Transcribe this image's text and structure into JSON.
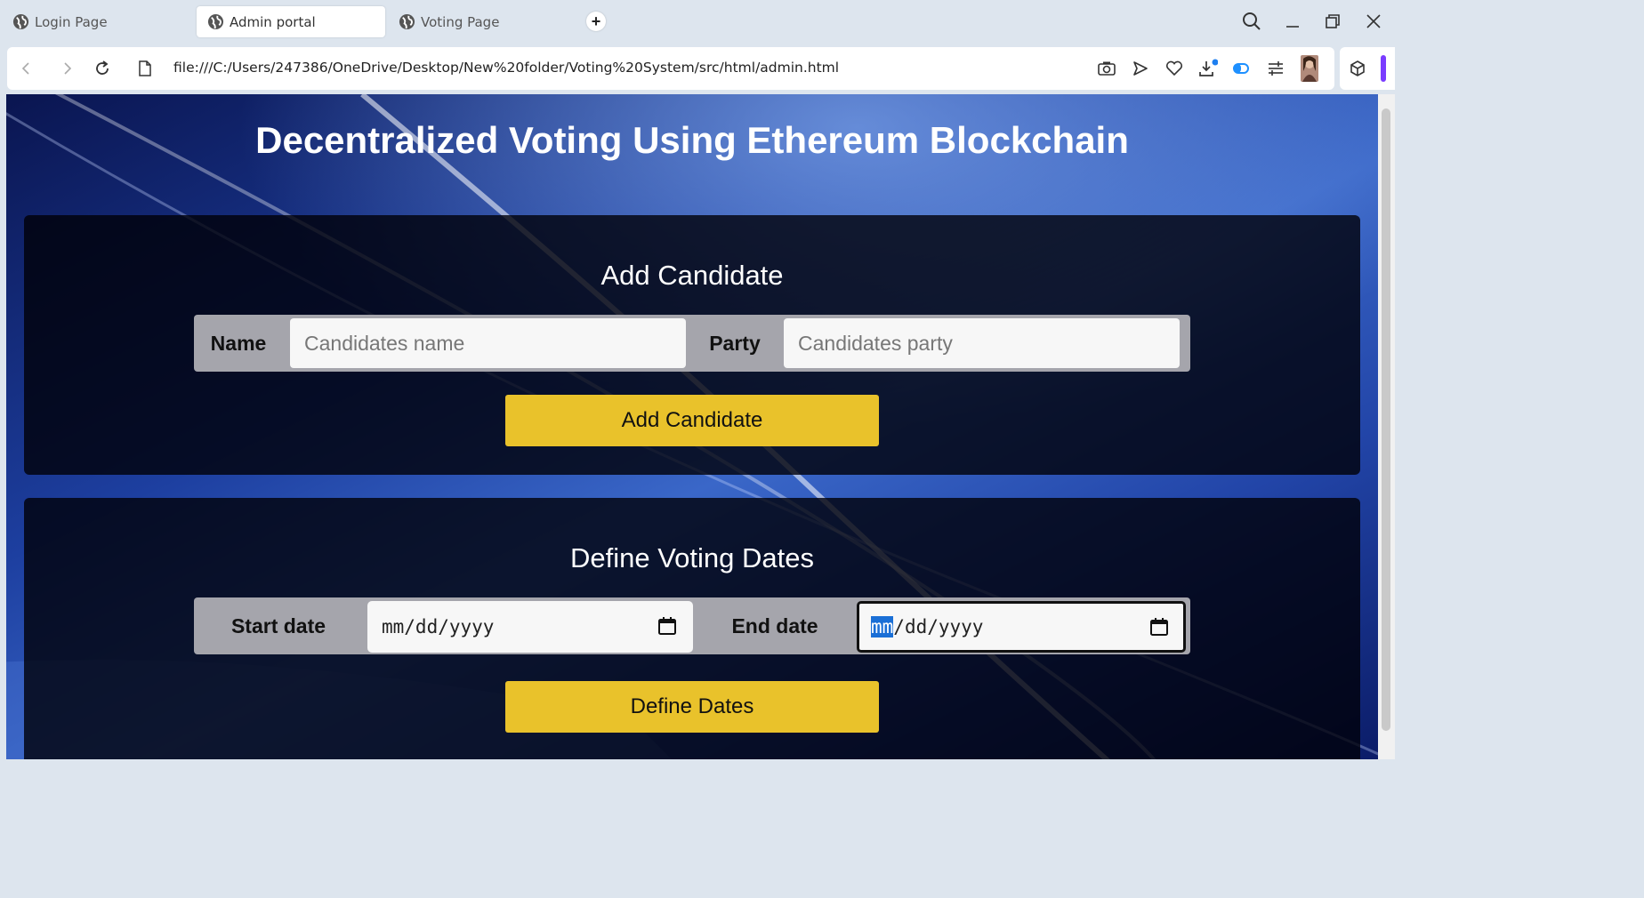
{
  "browser": {
    "tabs": [
      {
        "label": "Login Page",
        "active": false
      },
      {
        "label": "Admin portal",
        "active": true
      },
      {
        "label": "Voting Page",
        "active": false
      }
    ],
    "url": "file:///C:/Users/247386/OneDrive/Desktop/New%20folder/Voting%20System/src/html/admin.html"
  },
  "page": {
    "title": "Decentralized Voting Using Ethereum Blockchain",
    "add_candidate": {
      "heading": "Add Candidate",
      "name_label": "Name",
      "name_placeholder": "Candidates name",
      "party_label": "Party",
      "party_placeholder": "Candidates party",
      "button_label": "Add Candidate"
    },
    "voting_dates": {
      "heading": "Define Voting Dates",
      "start_label": "Start date",
      "start_value": "mm/dd/yyyy",
      "end_label": "End date",
      "end_value_highlight": "mm",
      "end_value_rest": "/dd/yyyy",
      "button_label": "Define Dates"
    }
  },
  "colors": {
    "button_yellow": "#e9c22b",
    "page_blue": "#0a1a55",
    "highlight_blue": "#1a6fd6"
  }
}
